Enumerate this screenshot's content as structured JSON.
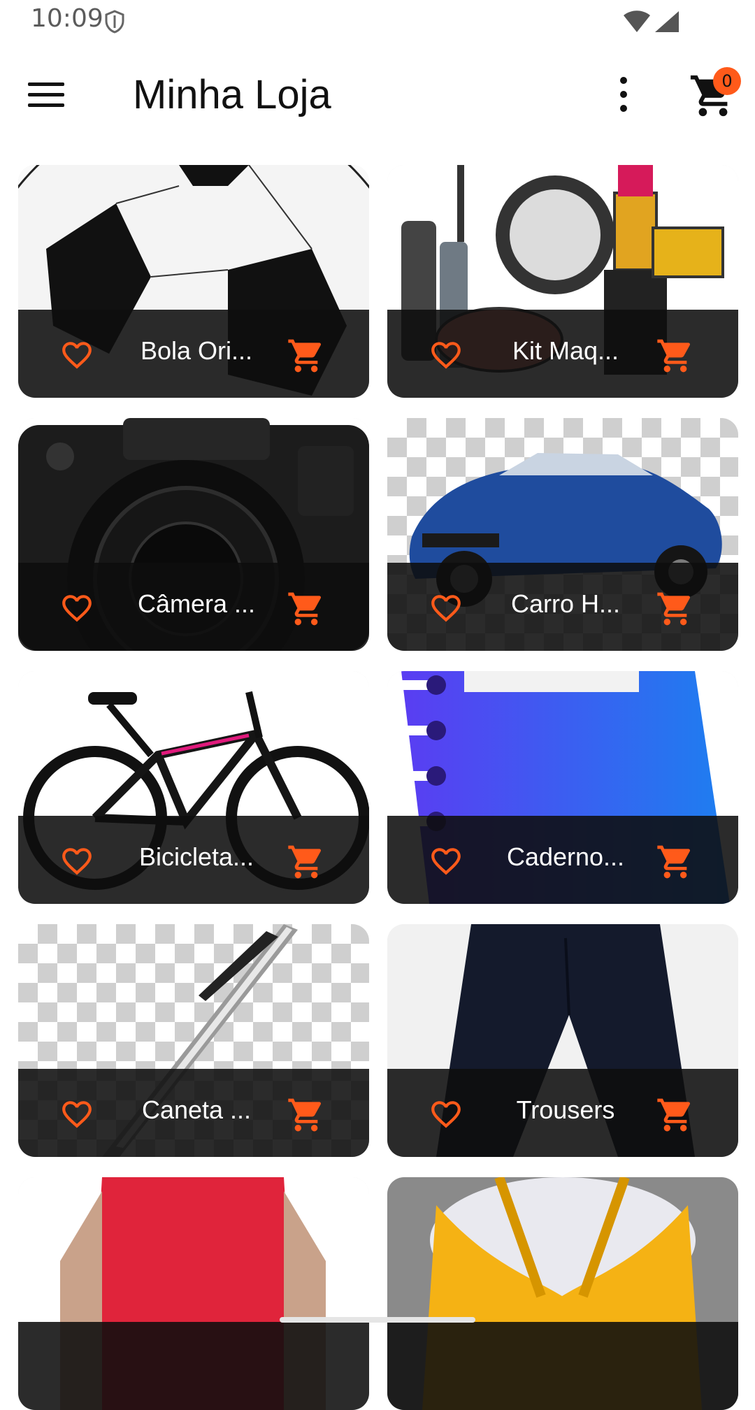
{
  "status_bar": {
    "time": "10:09"
  },
  "app_bar": {
    "title": "Minha Loja",
    "cart_count": "0"
  },
  "colors": {
    "accent": "#ff5a1a",
    "overlay": "#0e0e0e"
  },
  "products": [
    {
      "name": "Bola Ori...",
      "image": "soccer-ball"
    },
    {
      "name": "Kit Maq...",
      "image": "makeup-kit"
    },
    {
      "name": "Câmera ...",
      "image": "canon-camera"
    },
    {
      "name": "Carro H...",
      "image": "blue-car"
    },
    {
      "name": "Bicicleta...",
      "image": "bicycle"
    },
    {
      "name": "Caderno...",
      "image": "blue-notebook"
    },
    {
      "name": "Caneta ...",
      "image": "pen"
    },
    {
      "name": "Trousers",
      "image": "black-trousers"
    },
    {
      "name": "",
      "image": "red-tshirt"
    },
    {
      "name": "",
      "image": "yellow-scarf"
    }
  ]
}
